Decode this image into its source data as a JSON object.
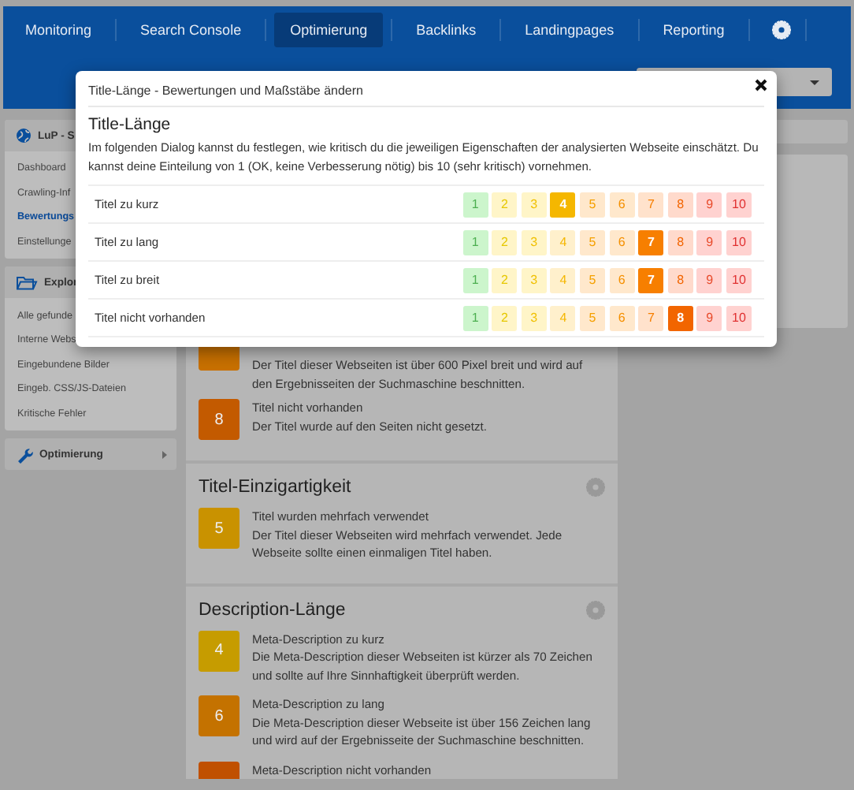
{
  "nav": {
    "tabs": [
      {
        "label": "Monitoring",
        "selected": false
      },
      {
        "label": "Search Console",
        "selected": false
      },
      {
        "label": "Optimierung",
        "selected": true
      },
      {
        "label": "Backlinks",
        "selected": false
      },
      {
        "label": "Landingpages",
        "selected": false
      },
      {
        "label": "Reporting",
        "selected": false
      }
    ]
  },
  "sidebar": {
    "sections": [
      {
        "kind": "project",
        "title": "LuP - S",
        "expanded": true,
        "items": [
          {
            "label": "Dashboard",
            "selected": false
          },
          {
            "label": "Crawling-Inf",
            "selected": false
          },
          {
            "label": "Bewertungs",
            "selected": true
          },
          {
            "label": "Einstellunge",
            "selected": false
          }
        ]
      },
      {
        "kind": "explorer",
        "title": "Explor",
        "expanded": true,
        "items": [
          {
            "label": "Alle gefunde",
            "selected": false
          },
          {
            "label": "Interne Webs",
            "selected": false
          },
          {
            "label": "Eingebundene Bilder",
            "selected": false
          },
          {
            "label": "Eingeb. CSS/JS-Dateien",
            "selected": false
          },
          {
            "label": "Kritische Fehler",
            "selected": false
          }
        ]
      },
      {
        "kind": "tools",
        "title": "Optimierung",
        "expanded": false
      }
    ]
  },
  "content": {
    "sections": [
      {
        "items": [
          {
            "color": "#c77000",
            "text": "Der Titel dieser Webseiten ist über 600 Pixel breit und wird auf den Ergebnisseiten der Suchmaschine beschnitten."
          },
          {
            "number": "8",
            "color": "#c35a00",
            "title": "Titel nicht vorhanden",
            "text": "Der Titel wurde auf den Seiten nicht gesetzt."
          }
        ]
      },
      {
        "heading": "Titel-Einzigartigkeit",
        "items": [
          {
            "number": "5",
            "color": "#c99200",
            "title": "Titel wurden mehrfach verwendet",
            "text": "Der Titel dieser Webseiten wird mehrfach verwendet. Jede Webseite sollte einen einmaligen Titel haben."
          }
        ]
      },
      {
        "heading": "Description-Länge",
        "items": [
          {
            "number": "4",
            "color": "#c69c00",
            "title": "Meta-Description zu kurz",
            "text": "Die Meta-Description dieser Webseiten ist kürzer als 70 Zeichen und sollte auf Ihre Sinnhaftigkeit überprüft werden."
          },
          {
            "number": "6",
            "color": "#c47200",
            "title": "Meta-Description zu lang",
            "text": "Die Meta-Description dieser Webseite ist über 156 Zeichen lang und wird auf der Ergebnisseite der Suchmaschine beschnitten."
          },
          {
            "color": "#c05000",
            "title": "Meta-Description nicht vorhanden"
          }
        ]
      }
    ]
  },
  "dialog": {
    "title": "Title-Länge - Bewertungen und Maßstäbe ändern",
    "heading": "Title-Länge",
    "text": "Im folgenden Dialog kannst du festlegen, wie kritisch du die jeweiligen Eigenschaften der analysierten Webseite einschätzt. Du kannst deine Einteilung von 1 (OK, keine Verbesserung nötig) bis 10 (sehr kritisch) vornehmen.",
    "rows": [
      {
        "label": "Titel zu kurz",
        "options": [
          {
            "label": "1",
            "selected": false
          },
          {
            "label": "2",
            "selected": false
          },
          {
            "label": "3",
            "selected": false
          },
          {
            "label": "4",
            "selected": true
          },
          {
            "label": "5",
            "selected": false
          },
          {
            "label": "6",
            "selected": false
          },
          {
            "label": "7",
            "selected": false
          },
          {
            "label": "8",
            "selected": false
          },
          {
            "label": "9",
            "selected": false
          },
          {
            "label": "10",
            "selected": false
          }
        ]
      },
      {
        "label": "Titel zu lang",
        "options": [
          {
            "label": "1",
            "selected": false
          },
          {
            "label": "2",
            "selected": false
          },
          {
            "label": "3",
            "selected": false
          },
          {
            "label": "4",
            "selected": false
          },
          {
            "label": "5",
            "selected": false
          },
          {
            "label": "6",
            "selected": false
          },
          {
            "label": "7",
            "selected": true
          },
          {
            "label": "8",
            "selected": false
          },
          {
            "label": "9",
            "selected": false
          },
          {
            "label": "10",
            "selected": false
          }
        ]
      },
      {
        "label": "Titel zu breit",
        "options": [
          {
            "label": "1",
            "selected": false
          },
          {
            "label": "2",
            "selected": false
          },
          {
            "label": "3",
            "selected": false
          },
          {
            "label": "4",
            "selected": false
          },
          {
            "label": "5",
            "selected": false
          },
          {
            "label": "6",
            "selected": false
          },
          {
            "label": "7",
            "selected": true
          },
          {
            "label": "8",
            "selected": false
          },
          {
            "label": "9",
            "selected": false
          },
          {
            "label": "10",
            "selected": false
          }
        ]
      },
      {
        "label": "Titel nicht vorhanden",
        "options": [
          {
            "label": "1",
            "selected": false
          },
          {
            "label": "2",
            "selected": false
          },
          {
            "label": "3",
            "selected": false
          },
          {
            "label": "4",
            "selected": false
          },
          {
            "label": "5",
            "selected": false
          },
          {
            "label": "6",
            "selected": false
          },
          {
            "label": "7",
            "selected": false
          },
          {
            "label": "8",
            "selected": true
          },
          {
            "label": "9",
            "selected": false
          },
          {
            "label": "10",
            "selected": false
          }
        ]
      }
    ]
  }
}
